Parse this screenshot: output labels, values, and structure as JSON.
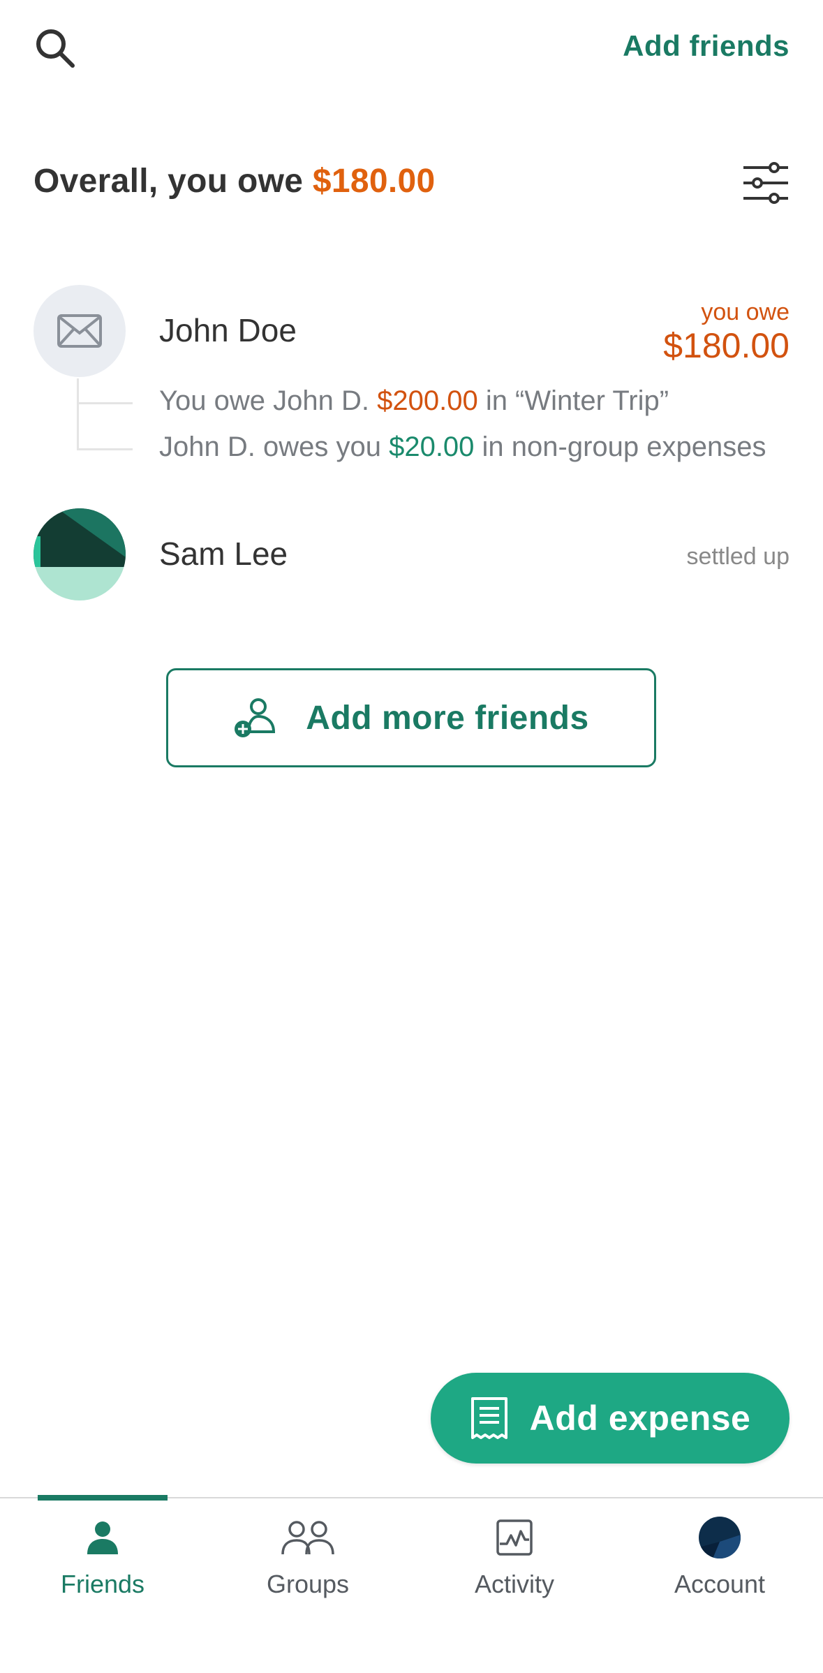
{
  "header": {
    "add_friends_label": "Add friends"
  },
  "overall": {
    "prefix": "Overall, you owe",
    "amount": "$180.00"
  },
  "friends": [
    {
      "name": "John Doe",
      "status_label": "you owe",
      "status_amount": "$180.00",
      "details": [
        {
          "pre": "You owe John D.",
          "amount": "$200.00",
          "post": "in “Winter Trip”"
        },
        {
          "pre": "John D. owes you",
          "amount": "$20.00",
          "post": "in non-group expenses"
        }
      ]
    },
    {
      "name": "Sam Lee",
      "status_text": "settled up"
    }
  ],
  "add_more_label": "Add more friends",
  "fab_label": "Add expense",
  "nav": [
    {
      "label": "Friends",
      "icon": "person-icon",
      "active": true
    },
    {
      "label": "Groups",
      "icon": "people-icon",
      "active": false
    },
    {
      "label": "Activity",
      "icon": "activity-icon",
      "active": false
    },
    {
      "label": "Account",
      "icon": "account-avatar",
      "active": false
    }
  ],
  "colors": {
    "accent": "#1a7a63",
    "fab": "#1ea884",
    "owe": "#d2520f",
    "owed": "#1a8a6c"
  }
}
